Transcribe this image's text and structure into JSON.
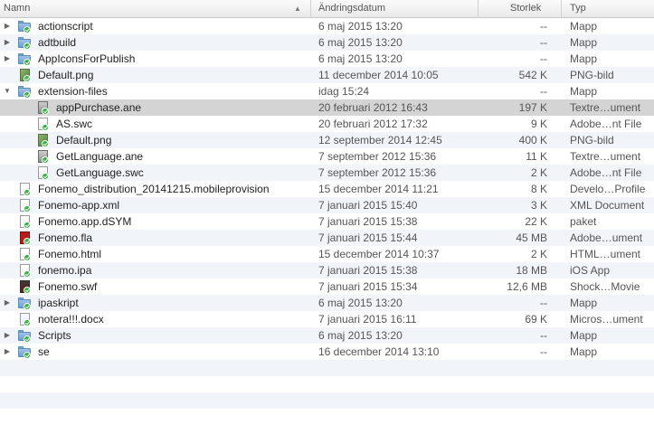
{
  "header": {
    "name": "Namn",
    "date": "Ändringsdatum",
    "size": "Storlek",
    "kind": "Typ"
  },
  "rows": [
    {
      "name": "actionscript",
      "date": "6 maj 2015 13:20",
      "size": "--",
      "kind": "Mapp",
      "icon": "folder-icon",
      "depth": 0,
      "expander": "collapsed",
      "alt": false,
      "selected": false
    },
    {
      "name": "adtbuild",
      "date": "6 maj 2015 13:20",
      "size": "--",
      "kind": "Mapp",
      "icon": "folder-icon",
      "depth": 0,
      "expander": "collapsed",
      "alt": true,
      "selected": false
    },
    {
      "name": "AppIconsForPublish",
      "date": "6 maj 2015 13:20",
      "size": "--",
      "kind": "Mapp",
      "icon": "folder-icon",
      "depth": 0,
      "expander": "collapsed",
      "alt": false,
      "selected": false
    },
    {
      "name": "Default.png",
      "date": "11 december 2014 10:05",
      "size": "542 K",
      "kind": "PNG-bild",
      "icon": "image-file-icon",
      "depth": 0,
      "expander": "none",
      "alt": true,
      "selected": false
    },
    {
      "name": "extension-files",
      "date": "idag 15:24",
      "size": "--",
      "kind": "Mapp",
      "icon": "folder-icon",
      "depth": 0,
      "expander": "expanded",
      "alt": false,
      "selected": false
    },
    {
      "name": "appPurchase.ane",
      "date": "20 februari 2012 16:43",
      "size": "197 K",
      "kind": "Textre…ument",
      "icon": "ane-file-icon",
      "depth": 1,
      "expander": "none",
      "alt": true,
      "selected": true
    },
    {
      "name": "AS.swc",
      "date": "20 februari 2012 17:32",
      "size": "9 K",
      "kind": "Adobe…nt File",
      "icon": "swc-file-icon",
      "depth": 1,
      "expander": "none",
      "alt": false,
      "selected": false
    },
    {
      "name": "Default.png",
      "date": "12 september 2014 12:45",
      "size": "400 K",
      "kind": "PNG-bild",
      "icon": "image-file-icon",
      "depth": 1,
      "expander": "none",
      "alt": true,
      "selected": false
    },
    {
      "name": "GetLanguage.ane",
      "date": "7 september 2012 15:36",
      "size": "11 K",
      "kind": "Textre…ument",
      "icon": "ane-file-icon",
      "depth": 1,
      "expander": "none",
      "alt": false,
      "selected": false
    },
    {
      "name": "GetLanguage.swc",
      "date": "7 september 2012 15:36",
      "size": "2 K",
      "kind": "Adobe…nt File",
      "icon": "swc-file-icon",
      "depth": 1,
      "expander": "none",
      "alt": true,
      "selected": false
    },
    {
      "name": "Fonemo_distribution_20141215.mobileprovision",
      "date": "15 december 2014 11:21",
      "size": "8 K",
      "kind": "Develo…Profile",
      "icon": "provision-file-icon",
      "depth": 0,
      "expander": "none",
      "alt": false,
      "selected": false
    },
    {
      "name": "Fonemo-app.xml",
      "date": "7 januari 2015 15:40",
      "size": "3 K",
      "kind": "XML Document",
      "icon": "xml-file-icon",
      "depth": 0,
      "expander": "none",
      "alt": true,
      "selected": false
    },
    {
      "name": "Fonemo.app.dSYM",
      "date": "7 januari 2015 15:38",
      "size": "22 K",
      "kind": "paket",
      "icon": "package-file-icon",
      "depth": 0,
      "expander": "none",
      "alt": false,
      "selected": false
    },
    {
      "name": "Fonemo.fla",
      "date": "7 januari 2015 15:44",
      "size": "45 MB",
      "kind": "Adobe…ument",
      "icon": "flash-file-icon",
      "depth": 0,
      "expander": "none",
      "alt": true,
      "selected": false
    },
    {
      "name": "Fonemo.html",
      "date": "15 december 2014 10:37",
      "size": "2 K",
      "kind": "HTML…ument",
      "icon": "html-file-icon",
      "depth": 0,
      "expander": "none",
      "alt": false,
      "selected": false
    },
    {
      "name": "fonemo.ipa",
      "date": "7 januari 2015 15:38",
      "size": "18 MB",
      "kind": "iOS App",
      "icon": "ipa-file-icon",
      "depth": 0,
      "expander": "none",
      "alt": true,
      "selected": false
    },
    {
      "name": "Fonemo.swf",
      "date": "7 januari 2015 15:34",
      "size": "12,6 MB",
      "kind": "Shock…Movie",
      "icon": "swf-file-icon",
      "depth": 0,
      "expander": "none",
      "alt": false,
      "selected": false
    },
    {
      "name": "ipaskript",
      "date": "6 maj 2015 13:20",
      "size": "--",
      "kind": "Mapp",
      "icon": "folder-icon",
      "depth": 0,
      "expander": "collapsed",
      "alt": true,
      "selected": false
    },
    {
      "name": "notera!!!.docx",
      "date": "7 januari 2015 16:11",
      "size": "69 K",
      "kind": "Micros…ument",
      "icon": "docx-file-icon",
      "depth": 0,
      "expander": "none",
      "alt": false,
      "selected": false
    },
    {
      "name": "Scripts",
      "date": "6 maj 2015 13:20",
      "size": "--",
      "kind": "Mapp",
      "icon": "folder-icon",
      "depth": 0,
      "expander": "collapsed",
      "alt": true,
      "selected": false
    },
    {
      "name": "se",
      "date": "16 december 2014 13:10",
      "size": "--",
      "kind": "Mapp",
      "icon": "folder-icon",
      "depth": 0,
      "expander": "collapsed",
      "alt": false,
      "selected": false
    }
  ],
  "sync_status": "synced"
}
